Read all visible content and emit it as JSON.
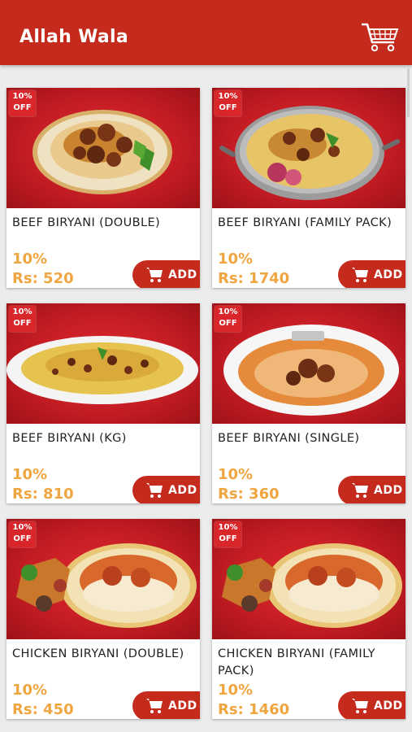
{
  "app": {
    "title": "Allah Wala",
    "cart_icon": "cart-icon"
  },
  "products": [
    {
      "badge_line1": "10%",
      "badge_line2": "OFF",
      "name": "BEEF BIRYANI (DOUBLE)",
      "discount": "10%",
      "price": "Rs: 520",
      "add_label": "ADD"
    },
    {
      "badge_line1": "10%",
      "badge_line2": "OFF",
      "name": "BEEF BIRYANI (FAMILY PACK)",
      "discount": "10%",
      "price": "Rs: 1740",
      "add_label": "ADD"
    },
    {
      "badge_line1": "10%",
      "badge_line2": "OFF",
      "name": "BEEF BIRYANI (KG)",
      "discount": "10%",
      "price": "Rs: 810",
      "add_label": "ADD"
    },
    {
      "badge_line1": "10%",
      "badge_line2": "OFF",
      "name": "BEEF BIRYANI (SINGLE)",
      "discount": "10%",
      "price": "Rs: 360",
      "add_label": "ADD"
    },
    {
      "badge_line1": "10%",
      "badge_line2": "OFF",
      "name": "CHICKEN BIRYANI (DOUBLE)",
      "discount": "10%",
      "price": "Rs: 450",
      "add_label": "ADD"
    },
    {
      "badge_line1": "10%",
      "badge_line2": "OFF",
      "name": "CHICKEN BIRYANI (FAMILY PACK)",
      "discount": "10%",
      "price": "Rs: 1460",
      "add_label": "ADD"
    }
  ],
  "colors": {
    "brand": "#c52b1c",
    "price": "#f0a640",
    "background": "#ececec"
  }
}
